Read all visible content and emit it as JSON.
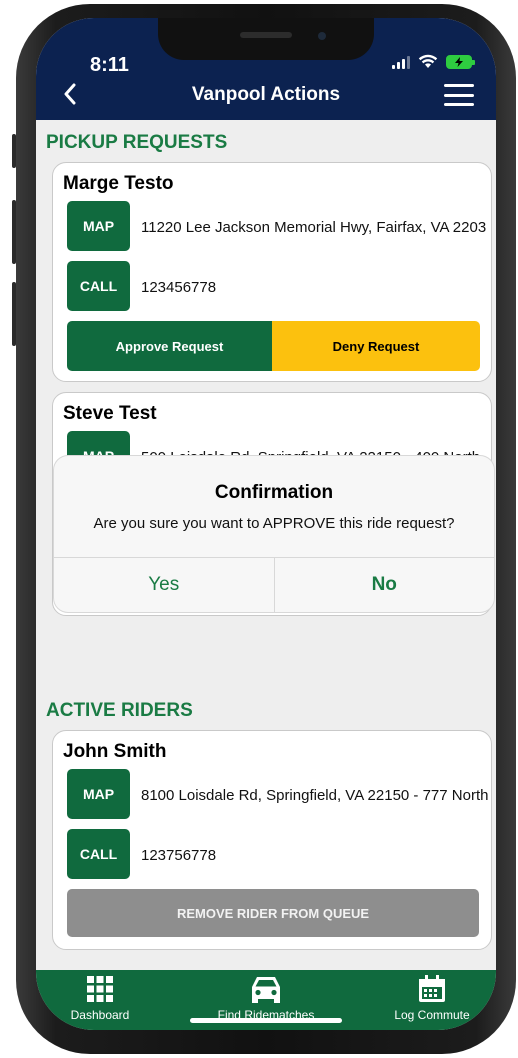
{
  "status_bar": {
    "time": "8:11"
  },
  "header": {
    "title": "Vanpool Actions"
  },
  "pickup_section": {
    "title": "PICKUP REQUESTS",
    "requests": [
      {
        "name": "Marge Testo",
        "map_label": "MAP",
        "address": "11220 Lee Jackson Memorial Hwy, Fairfax, VA 2203",
        "call_label": "CALL",
        "phone": "123456778",
        "approve_label": "Approve Request",
        "deny_label": "Deny Request"
      },
      {
        "name": "Steve Test",
        "map_label": "MAP",
        "address": "500 Loisdale Rd, Springfield, VA 22150 - 400 North"
      }
    ]
  },
  "dialog": {
    "title": "Confirmation",
    "message": "Are you sure you want to APPROVE this ride request?",
    "yes_label": "Yes",
    "no_label": "No"
  },
  "active_section": {
    "title": "ACTIVE RIDERS",
    "riders": [
      {
        "name": "John Smith",
        "map_label": "MAP",
        "address": "8100 Loisdale Rd, Springfield, VA 22150 - 777 North",
        "call_label": "CALL",
        "phone": "123756778",
        "remove_label": "REMOVE RIDER FROM QUEUE"
      }
    ]
  },
  "tabbar": {
    "items": [
      {
        "label": "Dashboard",
        "icon": "grid-icon"
      },
      {
        "label": "Find Ridematches",
        "icon": "car-icon"
      },
      {
        "label": "Log Commute",
        "icon": "calendar-icon"
      }
    ]
  },
  "colors": {
    "header_bg": "#0c2250",
    "brand_green": "#106a3e",
    "section_title_green": "#1a7b44",
    "deny_yellow": "#fcc10e",
    "remove_gray": "#8e8e8e"
  }
}
